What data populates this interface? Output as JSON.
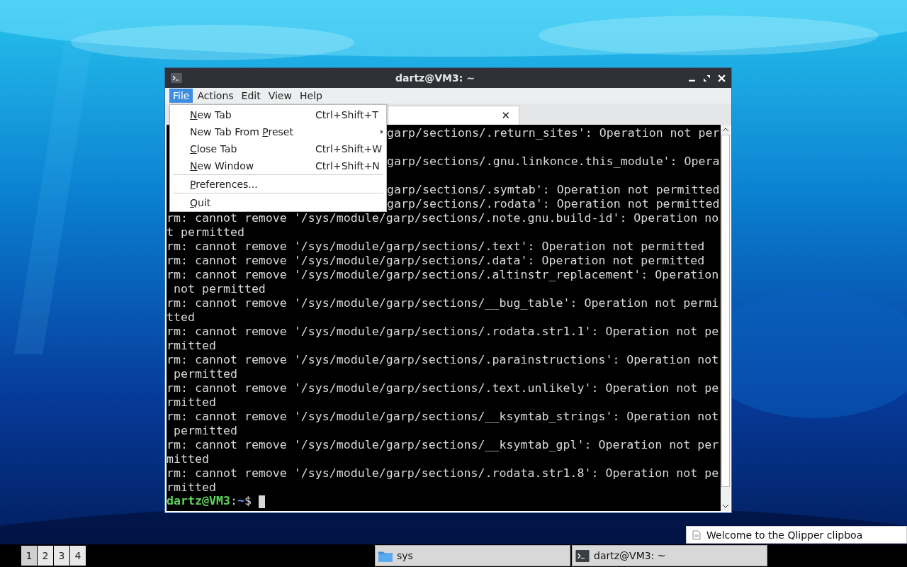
{
  "window": {
    "title": "dartz@VM3: ~"
  },
  "menu_bar": [
    {
      "label": "File",
      "selected": true
    },
    {
      "label": "Actions",
      "selected": false
    },
    {
      "label": "Edit",
      "selected": false
    },
    {
      "label": "View",
      "selected": false
    },
    {
      "label": "Help",
      "selected": false
    }
  ],
  "file_menu": [
    {
      "kind": "item",
      "key": "N",
      "after": "ew Tab",
      "shortcut": "Ctrl+Shift+T"
    },
    {
      "kind": "submenu",
      "before": "New Tab From ",
      "key": "P",
      "after": "reset"
    },
    {
      "kind": "item",
      "key": "C",
      "after": "lose Tab",
      "shortcut": "Ctrl+Shift+W"
    },
    {
      "kind": "item",
      "key": "N",
      "after": "ew Window",
      "shortcut": "Ctrl+Shift+N"
    },
    {
      "kind": "separator"
    },
    {
      "kind": "item",
      "key": "P",
      "after": "references..."
    },
    {
      "kind": "separator"
    },
    {
      "kind": "item",
      "key": "Q",
      "after": "uit"
    }
  ],
  "tab": {
    "close": "✕"
  },
  "terminal_lines": [
    {
      "kind": "partial-wrapped",
      "text": "garp/sections/.return_sites': Operation not per"
    },
    {
      "kind": "partial-wrapped",
      "text": "garp/sections/.gnu.linkonce.this_module': Opera"
    },
    {
      "kind": "partial",
      "text": "garp/sections/.symtab': Operation not permitted"
    },
    {
      "kind": "partial",
      "text": "garp/sections/.rodata': Operation not permitted"
    },
    {
      "kind": "full",
      "text": "rm: cannot remove '/sys/module/garp/sections/.note.gnu.build-id': Operation no"
    },
    {
      "kind": "full",
      "text": "t permitted"
    },
    {
      "kind": "full",
      "text": "rm: cannot remove '/sys/module/garp/sections/.text': Operation not permitted"
    },
    {
      "kind": "full",
      "text": "rm: cannot remove '/sys/module/garp/sections/.data': Operation not permitted"
    },
    {
      "kind": "full",
      "text": "rm: cannot remove '/sys/module/garp/sections/.altinstr_replacement': Operation"
    },
    {
      "kind": "full",
      "text": " not permitted"
    },
    {
      "kind": "full",
      "text": "rm: cannot remove '/sys/module/garp/sections/__bug_table': Operation not permi"
    },
    {
      "kind": "full",
      "text": "tted"
    },
    {
      "kind": "full",
      "text": "rm: cannot remove '/sys/module/garp/sections/.rodata.str1.1': Operation not pe"
    },
    {
      "kind": "full",
      "text": "rmitted"
    },
    {
      "kind": "full",
      "text": "rm: cannot remove '/sys/module/garp/sections/.parainstructions': Operation not"
    },
    {
      "kind": "full",
      "text": " permitted"
    },
    {
      "kind": "full",
      "text": "rm: cannot remove '/sys/module/garp/sections/.text.unlikely': Operation not pe"
    },
    {
      "kind": "full",
      "text": "rmitted"
    },
    {
      "kind": "full",
      "text": "rm: cannot remove '/sys/module/garp/sections/__ksymtab_strings': Operation not"
    },
    {
      "kind": "full",
      "text": " permitted"
    },
    {
      "kind": "full",
      "text": "rm: cannot remove '/sys/module/garp/sections/__ksymtab_gpl': Operation not per"
    },
    {
      "kind": "full",
      "text": "mitted"
    },
    {
      "kind": "full",
      "text": "rm: cannot remove '/sys/module/garp/sections/.rodata.str1.8': Operation not pe"
    },
    {
      "kind": "full",
      "text": "rmitted"
    }
  ],
  "prompt": {
    "user_host": "dartz@VM3",
    "separator": ":",
    "path": "~",
    "symbol": "$"
  },
  "notification": {
    "text": "Welcome to the Qlipper clipboa"
  },
  "taskbar": {
    "desktops": [
      {
        "label": "1",
        "selected": true
      },
      {
        "label": "2",
        "selected": false
      },
      {
        "label": "3",
        "selected": false
      },
      {
        "label": "4",
        "selected": false
      }
    ],
    "tasks": [
      {
        "kind": "folder",
        "label": "sys"
      },
      {
        "kind": "terminal",
        "label": "dartz@VM3: ~"
      }
    ]
  }
}
